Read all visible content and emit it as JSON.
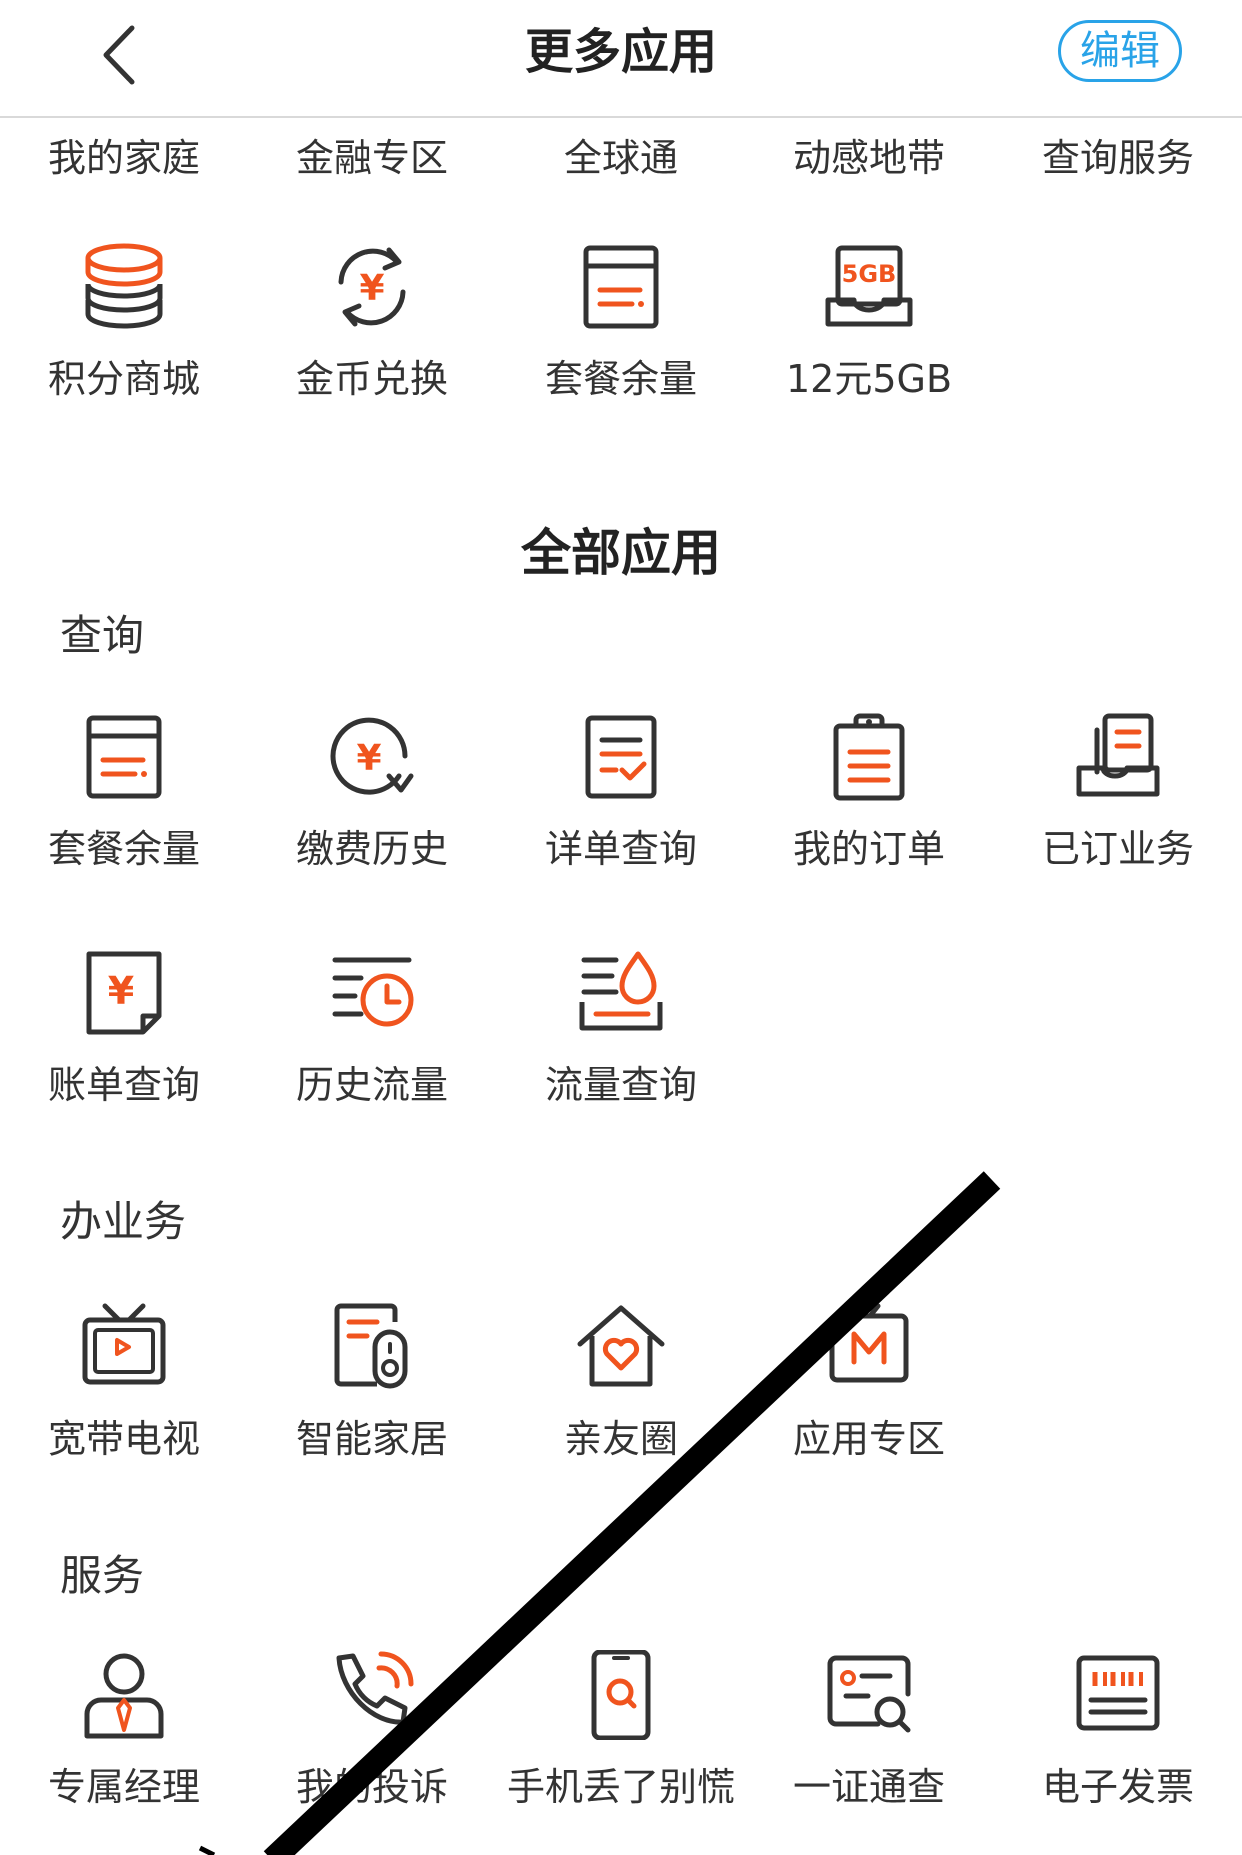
{
  "header": {
    "title": "更多应用",
    "edit_label": "编辑"
  },
  "top_tabs": [
    "我的家庭",
    "金融专区",
    "全球通",
    "动感地带",
    "查询服务"
  ],
  "pinned": [
    {
      "label": "积分商城",
      "icon": "coin-stack-icon"
    },
    {
      "label": "金币兑换",
      "icon": "yuan-exchange-icon"
    },
    {
      "label": "套餐余量",
      "icon": "package-card-icon"
    },
    {
      "label": "12元5GB",
      "icon": "data-5gb-icon",
      "badge": "5GB"
    }
  ],
  "all_apps_title": "全部应用",
  "sections": [
    {
      "title": "查询",
      "items": [
        {
          "label": "套餐余量",
          "icon": "package-card-icon"
        },
        {
          "label": "缴费历史",
          "icon": "yuan-history-icon"
        },
        {
          "label": "详单查询",
          "icon": "checklist-icon"
        },
        {
          "label": "我的订单",
          "icon": "clipboard-icon"
        },
        {
          "label": "已订业务",
          "icon": "subscribed-doc-icon"
        },
        {
          "label": "账单查询",
          "icon": "bill-yuan-icon"
        },
        {
          "label": "历史流量",
          "icon": "data-history-icon"
        },
        {
          "label": "流量查询",
          "icon": "data-drop-icon"
        }
      ]
    },
    {
      "title": "办业务",
      "items": [
        {
          "label": "宽带电视",
          "icon": "tv-icon"
        },
        {
          "label": "智能家居",
          "icon": "smart-home-icon"
        },
        {
          "label": "亲友圈",
          "icon": "family-house-icon"
        },
        {
          "label": "应用专区",
          "icon": "app-zone-icon"
        }
      ]
    },
    {
      "title": "服务",
      "items": [
        {
          "label": "专属经理",
          "icon": "manager-icon"
        },
        {
          "label": "我的投诉",
          "icon": "phone-complaint-icon"
        },
        {
          "label": "手机丢了别慌",
          "icon": "phone-search-icon"
        },
        {
          "label": "一证通查",
          "icon": "id-search-icon"
        },
        {
          "label": "电子发票",
          "icon": "invoice-icon"
        }
      ]
    }
  ],
  "colors": {
    "accent": "#f0541e",
    "line": "#333333",
    "edit_blue": "#29a3e8"
  }
}
